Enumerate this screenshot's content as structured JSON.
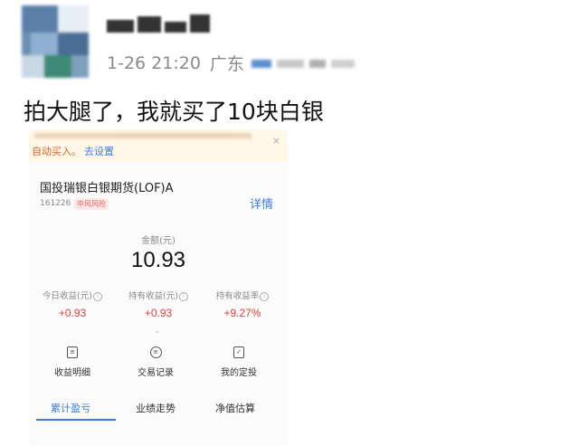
{
  "post": {
    "timestamp": "1-26 21:20",
    "location": "广东",
    "text": "拍大腿了，我就买了10块白银"
  },
  "card": {
    "banner": {
      "auto_text": "自动买入。",
      "link": "去设置",
      "close": "×"
    },
    "fund": {
      "name": "国投瑞银白银期货(LOF)A",
      "code": "161226",
      "tag": "中风风险",
      "detail_link": "详情"
    },
    "amount": {
      "label": "金额(元)",
      "value": "10.93"
    },
    "stats": [
      {
        "label": "今日收益(元)",
        "value": "+0.93"
      },
      {
        "label": "持有收益(元)",
        "value": "+0.93"
      },
      {
        "label": "持有收益率",
        "value": "+9.27%"
      }
    ],
    "actions": [
      {
        "label": "收益明细",
        "icon": "document-icon"
      },
      {
        "label": "交易记录",
        "icon": "record-icon"
      },
      {
        "label": "我的定投",
        "icon": "calendar-check-icon"
      }
    ],
    "tabs": [
      {
        "label": "累计盈亏",
        "active": true
      },
      {
        "label": "业绩走势",
        "active": false
      },
      {
        "label": "净值估算",
        "active": false
      }
    ],
    "colors": {
      "accent": "#3b7de3",
      "gain": "#e0403a",
      "banner_text": "#d9622b"
    }
  }
}
